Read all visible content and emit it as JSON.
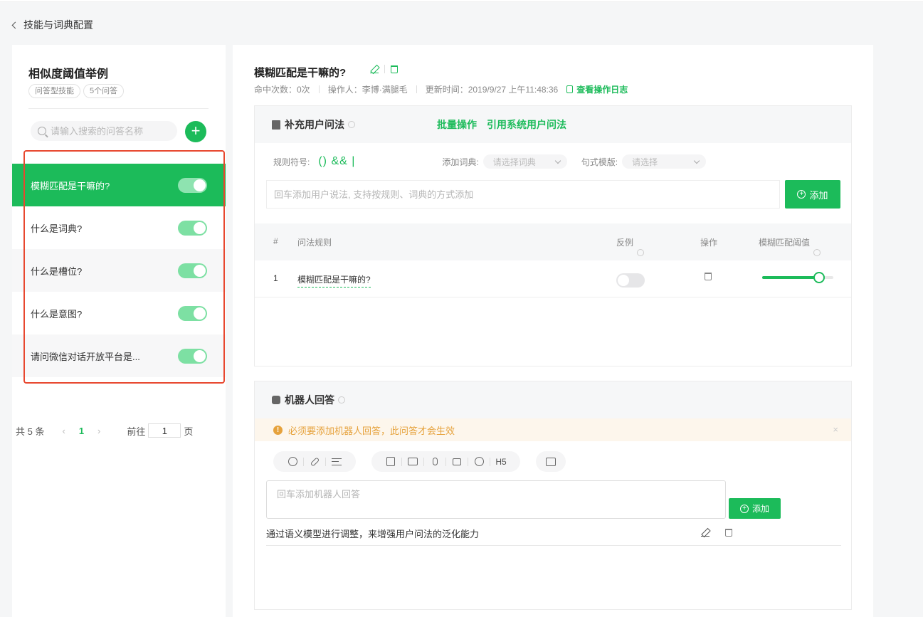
{
  "nav": {
    "back_label": "技能与词典配置"
  },
  "left": {
    "title": "相似度阈值举例",
    "tags": [
      "问答型技能",
      "5个问答"
    ],
    "search_placeholder": "请输入搜索的问答名称",
    "add_symbol": "+",
    "questions": [
      {
        "label": "模糊匹配是干嘛的?",
        "enabled": true,
        "active": true
      },
      {
        "label": "什么是词典?",
        "enabled": true,
        "active": false
      },
      {
        "label": "什么是槽位?",
        "enabled": true,
        "active": false
      },
      {
        "label": "什么是意图?",
        "enabled": true,
        "active": false
      },
      {
        "label": "请问微信对话开放平台是...",
        "enabled": true,
        "active": false
      }
    ],
    "pager": {
      "total": "共 5 条",
      "prev": "‹",
      "current": "1",
      "next": "›",
      "goto_label": "前往",
      "goto_value": "1",
      "page_suffix": "页"
    }
  },
  "detail": {
    "title": "模糊匹配是干嘛的?",
    "meta": {
      "hits": "命中次数：0次",
      "operator": "操作人：李博·满腿毛",
      "updated": "更新时间：2019/9/27 上午11:48:36",
      "log_link": "查看操作日志"
    }
  },
  "utterances": {
    "header": "补充用户问法",
    "batch_link": "批量操作",
    "cite_link": "引用系统用户问法",
    "rule_symbol_label": "规则符号:",
    "rule_symbols": "() && |",
    "dict_label": "添加词典:",
    "dict_placeholder": "请选择词典",
    "template_label": "句式模版:",
    "template_placeholder": "请选择",
    "input_placeholder": "回车添加用户说法, 支持按规则、词典的方式添加",
    "add_button": "添加",
    "columns": [
      "#",
      "问法规则",
      "反例",
      "操作",
      "模糊匹配阈值"
    ],
    "rows": [
      {
        "index": "1",
        "rule": "模糊匹配是干嘛的?",
        "counter_example": false,
        "threshold": 0.8
      }
    ]
  },
  "answers": {
    "header": "机器人回答",
    "warning": "必须要添加机器人回答，此问答才会生效",
    "warning_close": "×",
    "toolbar_groups": [
      [
        "emoji-icon",
        "link-icon",
        "wrap-icon"
      ],
      [
        "article-icon",
        "image-icon",
        "voice-icon",
        "video-icon",
        "miniprogram-icon",
        "H5"
      ],
      [
        "switch-icon"
      ]
    ],
    "h5_label": "H5",
    "input_placeholder": "回车添加机器人回答",
    "add_button": "添加",
    "items": [
      "通过语义模型进行调整，来增强用户问法的泛化能力"
    ]
  },
  "colors": {
    "accent": "#1cbb5a",
    "warning": "#e6a23c",
    "highlight_box": "#e8472f"
  }
}
